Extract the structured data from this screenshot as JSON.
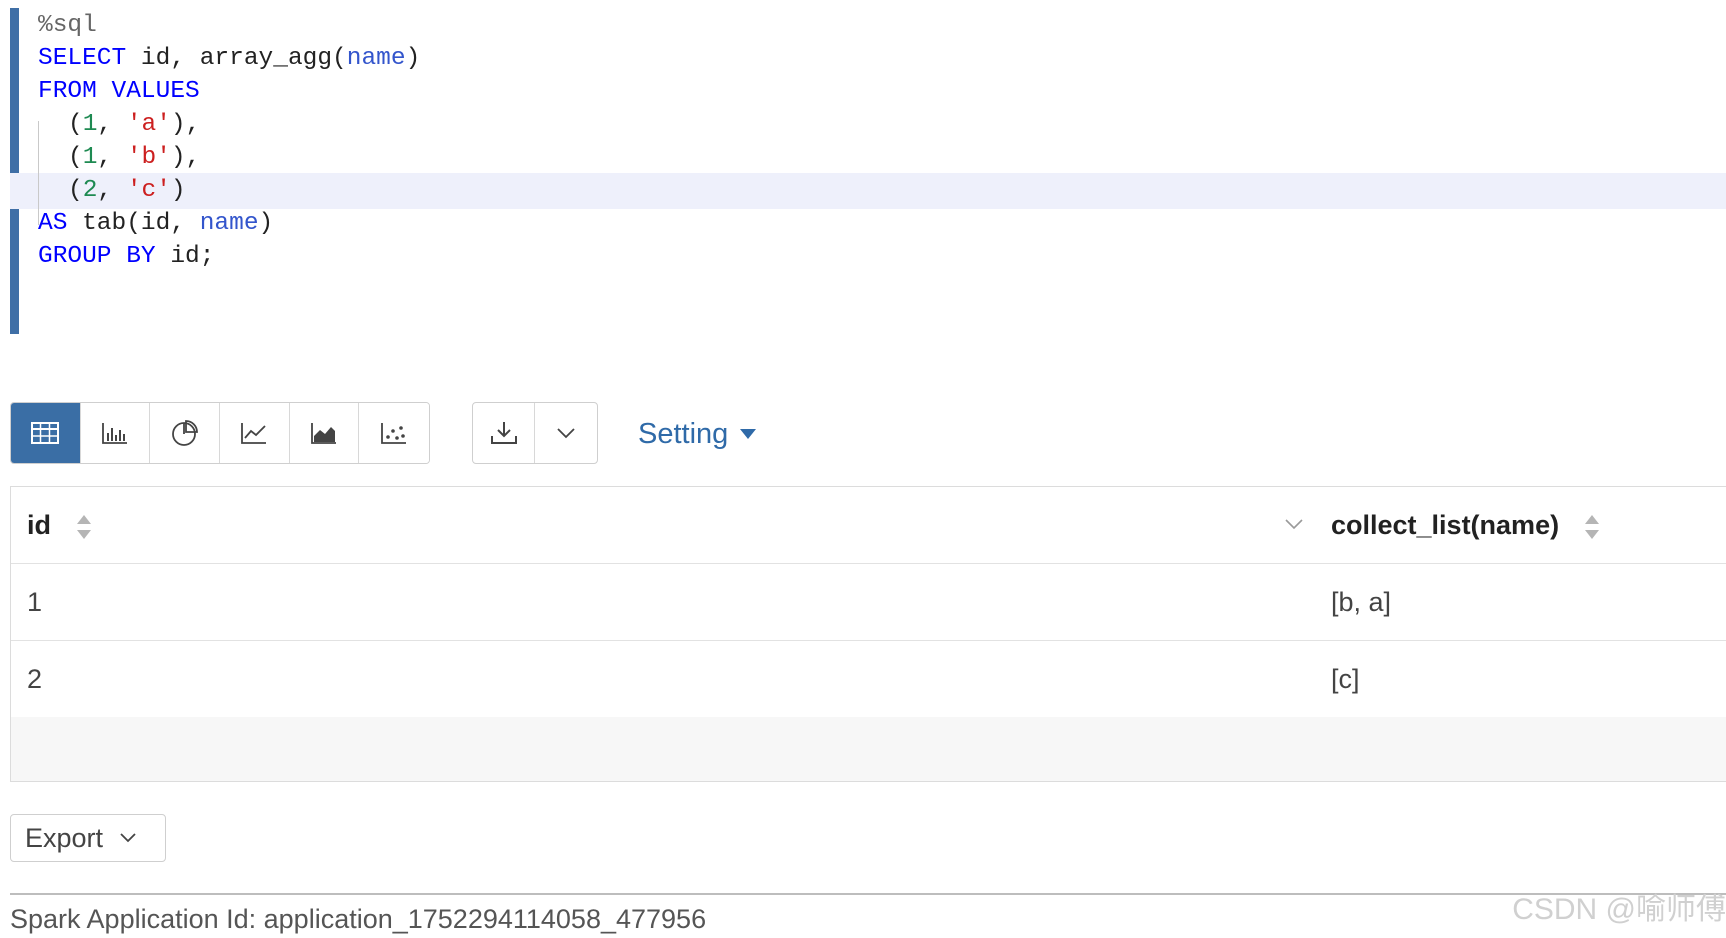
{
  "editor": {
    "magic": "%sql",
    "lines": [
      {
        "kw1": "SELECT",
        "rest": " id, array_agg(",
        "ident": "name",
        "close": ")"
      },
      {
        "kw1": "FROM",
        "kw2": "VALUES"
      },
      {
        "open": "(",
        "num": "1",
        "sep": ", ",
        "str": "'a'",
        "close": "),"
      },
      {
        "open": "(",
        "num": "1",
        "sep": ", ",
        "str": "'b'",
        "close": "),"
      },
      {
        "open": "(",
        "num": "2",
        "sep": ", ",
        "str": "'c'",
        "close": ")"
      },
      {
        "kw1": "AS",
        "rest": " tab(id, ",
        "ident": "name",
        "close": ")"
      },
      {
        "kw1": "GROUP",
        "kw2": "BY",
        "rest": " id;"
      }
    ]
  },
  "toolbar": {
    "chart_buttons": [
      {
        "icon": "table-icon",
        "active": true
      },
      {
        "icon": "bar-chart-icon",
        "active": false
      },
      {
        "icon": "pie-chart-icon",
        "active": false
      },
      {
        "icon": "line-chart-icon",
        "active": false
      },
      {
        "icon": "area-chart-icon",
        "active": false
      },
      {
        "icon": "scatter-chart-icon",
        "active": false
      }
    ],
    "download_icon": "download-icon",
    "dropdown_icon": "chevron-down-icon",
    "setting_label": "Setting",
    "accent_color": "#3a6ea5"
  },
  "table": {
    "columns": [
      "id",
      "collect_list(name)"
    ],
    "rows": [
      [
        "1",
        "[b, a]"
      ],
      [
        "2",
        "[c]"
      ]
    ]
  },
  "export": {
    "label": "Export"
  },
  "footer": {
    "app_id_text": "Spark Application Id: application_1752294114058_477956"
  },
  "watermark": "CSDN @喻师傅"
}
